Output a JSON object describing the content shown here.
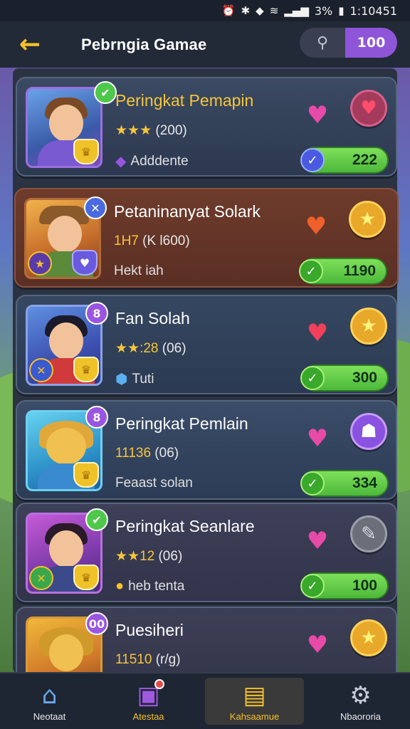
{
  "status_bar": {
    "icons": [
      "alarm-icon",
      "bluetooth-icon",
      "location-icon",
      "wifi-icon",
      "signal-icon"
    ],
    "battery": "3%",
    "time": "1:10451"
  },
  "header": {
    "title": "Pebrngia Gamae",
    "count": "100"
  },
  "players": [
    {
      "name": "Peringkat Pemapin",
      "rating_stars": "★★★",
      "rating_text": "(200)",
      "sub_label": "Adddente",
      "sub_icon": "crystal-icon",
      "score": "222",
      "action_icon": "heart-icon",
      "avatar_badge": "✔"
    },
    {
      "name": "Petaninanyat Solark",
      "rating_stars": "1H7",
      "rating_text": "(K l600)",
      "sub_label": "Hekt iah",
      "sub_icon": "",
      "score": "1190",
      "action_icon": "star-icon",
      "avatar_badge": "✕"
    },
    {
      "name": "Fan Solah",
      "rating_stars": "★★:28",
      "rating_text": "(06)",
      "sub_label": "Tuti",
      "sub_icon": "gem-icon",
      "score": "300",
      "action_icon": "star-icon",
      "avatar_badge": "8"
    },
    {
      "name": "Peringkat Pemlain",
      "rating_stars": "11136",
      "rating_text": "(06)",
      "sub_label": "Feaast solan",
      "sub_icon": "",
      "score": "334",
      "action_icon": "ghost-icon",
      "avatar_badge": "8"
    },
    {
      "name": "Peringkat Seanlare",
      "rating_stars": "★★12",
      "rating_text": "(06)",
      "sub_label": "heb tenta",
      "sub_icon": "coin-icon",
      "score": "100",
      "action_icon": "pencil-icon",
      "avatar_badge": "✔"
    },
    {
      "name": "Puesiheri",
      "rating_stars": "11510",
      "rating_text": "(r/g)",
      "sub_label": "",
      "sub_icon": "",
      "score": "",
      "action_icon": "star-icon",
      "avatar_badge": "00"
    }
  ],
  "bottom_nav": [
    {
      "label": "Neotaat",
      "icon": "home-icon"
    },
    {
      "label": "Atestaa",
      "icon": "shop-icon"
    },
    {
      "label": "Kahsaamue",
      "icon": "chest-icon"
    },
    {
      "label": "Nbaororia",
      "icon": "gear-icon"
    }
  ]
}
